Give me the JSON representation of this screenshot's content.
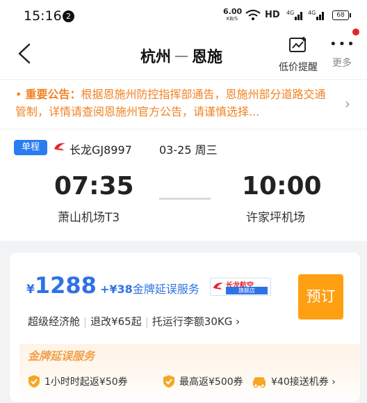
{
  "status_bar": {
    "time": "15:16",
    "notification_count": "2",
    "net_speed": "6.00",
    "net_unit": "KB/S",
    "hd_label": "HD",
    "signal1": "4G",
    "signal2": "4G",
    "battery": "68"
  },
  "header": {
    "from": "杭州",
    "to": "恩施",
    "price_alert_label": "低价提醒",
    "more_label": "更多"
  },
  "notice": {
    "title": "重要公告：",
    "text": "根据恩施州防控指挥部通告，恩施州部分道路交通管制，详情请查阅恩施州官方公告，请谨慎选择..."
  },
  "flight": {
    "trip_type": "单程",
    "airline_flight": "长龙GJ8997",
    "date": "03-25 周三",
    "dep_time": "07:35",
    "arr_time": "10:00",
    "dep_airport": "萧山机场T3",
    "arr_airport": "许家坪机场"
  },
  "offer": {
    "currency": "¥",
    "price": "1288",
    "extra_price": "+¥38",
    "extra_service": "金牌延误服务",
    "airline_badge_name": "长龙航空",
    "airline_badge_sub": "旗舰店",
    "book_label": "预订",
    "cabin": "超级经济舱",
    "refund": "退改¥65起",
    "baggage": "托运行李额30KG",
    "service_title": "金牌延误服务",
    "benefits": [
      "1小时时起返¥50券",
      "最高返¥500券",
      "¥40接送机券"
    ]
  },
  "colors": {
    "accent_blue": "#2f72e6",
    "book_orange": "#ff9f12",
    "notice_orange": "#f08223",
    "badge_red": "#e8232a"
  }
}
